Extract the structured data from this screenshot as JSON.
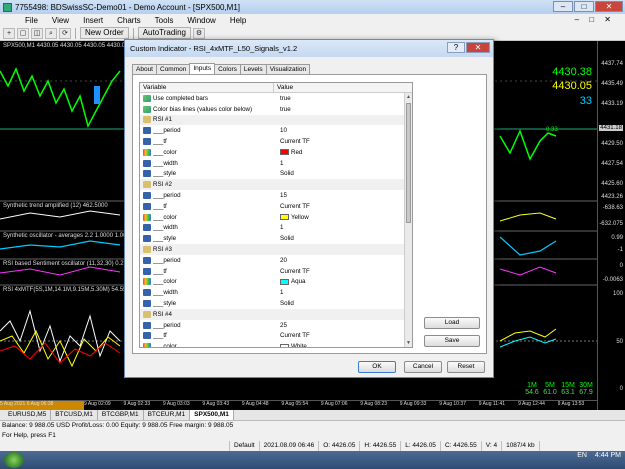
{
  "window": {
    "title": "7755498: BDSwissSC-Demo01 - Demo Account - [SPX500,M1]",
    "controls": [
      "–",
      "□",
      "✕"
    ]
  },
  "menu": {
    "items": [
      "File",
      "View",
      "Insert",
      "Charts",
      "Tools",
      "Window",
      "Help"
    ],
    "mdi_controls": "– □ ✕"
  },
  "toolbar": {
    "new_order": "New Order",
    "autotrading": "AutoTrading",
    "buttons": [
      "+",
      "▢",
      "◫",
      "⌕",
      "⟳",
      "⚙"
    ]
  },
  "chart": {
    "main_label": "SPX500,M1  4430.05 4430.05 4430.05 4430.05",
    "price_big": [
      "4430.38",
      "4430.05",
      "33"
    ],
    "price_colors": [
      "#00ff00",
      "#ffff00",
      "#00d0ff"
    ],
    "current_marker": "0.33",
    "sub_labels": [
      "Synthetic trend amplified (12) 462.5000",
      "Synthetic oscillator - averages 2.2 1.0000 1.0000",
      "RSI based Sentiment oscillator (11,32,30) 0.29",
      "RSI 4xMTF(5S,1M,14.1M,9.15M,5.30M) 54.5583 60"
    ],
    "right_axis": [
      "4437.74",
      "4435.49",
      "4433.19",
      "4431.18",
      "4429.50",
      "4427.54",
      "4425.60",
      "4423.26",
      "-638.63",
      "-632.075",
      "0.99",
      "-1",
      "0",
      "-0.0063",
      "100",
      "50",
      "0"
    ],
    "time_axis": [
      "5 Aug 2021",
      "6 Aug 06:38",
      "9 Aug 02:09",
      "9 Aug 02:33",
      "9 Aug 03:03",
      "9 Aug 03:43",
      "9 Aug 04:48",
      "9 Aug 05:54",
      "9 Aug 07:06",
      "9 Aug 08:23",
      "9 Aug 09:33",
      "9 Aug 10:37",
      "9 Aug 11:41",
      "9 Aug 12:44",
      "9 Aug 13:53"
    ],
    "mtf": {
      "headers": [
        "1M",
        "5M",
        "15M",
        "30M"
      ],
      "values": [
        "54.6",
        "61.0",
        "63.1",
        "67.9"
      ]
    }
  },
  "chart_tabs": [
    "EURUSD,M5",
    "BTCUSD,M1",
    "BTCGBP,M1",
    "BTCEUR,M1",
    "SPX500,M1"
  ],
  "active_chart_tab": "SPX500,M1",
  "account_bar": "Balance: 9 988.05 USD  Profit/Loss: 0.00  Equity: 9 988.05  Free margin: 9 988.05",
  "status": {
    "help": "For Help, press F1",
    "profile": "Default",
    "datetime": "2021.08.09 06:46",
    "open": "O: 4426.05",
    "high": "H: 4426.55",
    "low": "L: 4426.05",
    "close": "C: 4426.55",
    "volume": "V: 4",
    "traffic": "1087/4 kb"
  },
  "taskbar": {
    "lang": "EN",
    "time": "4:44 PM"
  },
  "dialog": {
    "title": "Custom Indicator - RSI_4xMTF_L50_Signals_v1.2",
    "help": "?",
    "close": "✕",
    "tabs": [
      "About",
      "Common",
      "Inputs",
      "Colors",
      "Levels",
      "Visualization"
    ],
    "active_tab": "Inputs",
    "columns": [
      "Variable",
      "Value"
    ],
    "rows": [
      {
        "icon": "bool",
        "name": "Use completed bars",
        "value": "true"
      },
      {
        "icon": "bool",
        "name": "Color bias lines (values color below)",
        "value": "true"
      },
      {
        "icon": "group",
        "name": "RSI #1",
        "value": ""
      },
      {
        "icon": "num",
        "name": "___period",
        "value": "10"
      },
      {
        "icon": "num",
        "name": "___tf",
        "value": "Current TF"
      },
      {
        "icon": "color",
        "name": "___color",
        "value": "Red",
        "swatch": "#ff0000"
      },
      {
        "icon": "num",
        "name": "___width",
        "value": "1"
      },
      {
        "icon": "num",
        "name": "___style",
        "value": "Solid"
      },
      {
        "icon": "group",
        "name": "RSI #2",
        "value": ""
      },
      {
        "icon": "num",
        "name": "___period",
        "value": "15"
      },
      {
        "icon": "num",
        "name": "___tf",
        "value": "Current TF"
      },
      {
        "icon": "color",
        "name": "___color",
        "value": "Yellow",
        "swatch": "#ffff00"
      },
      {
        "icon": "num",
        "name": "___width",
        "value": "1"
      },
      {
        "icon": "num",
        "name": "___style",
        "value": "Solid"
      },
      {
        "icon": "group",
        "name": "RSI #3",
        "value": ""
      },
      {
        "icon": "num",
        "name": "___period",
        "value": "20"
      },
      {
        "icon": "num",
        "name": "___tf",
        "value": "Current TF"
      },
      {
        "icon": "color",
        "name": "___color",
        "value": "Aqua",
        "swatch": "#00ffff"
      },
      {
        "icon": "num",
        "name": "___width",
        "value": "1"
      },
      {
        "icon": "num",
        "name": "___style",
        "value": "Solid"
      },
      {
        "icon": "group",
        "name": "RSI #4",
        "value": ""
      },
      {
        "icon": "num",
        "name": "___period",
        "value": "25"
      },
      {
        "icon": "num",
        "name": "___tf",
        "value": "Current TF"
      },
      {
        "icon": "color",
        "name": "___color",
        "value": "White",
        "swatch": "#ffffff"
      }
    ],
    "buttons": {
      "load": "Load",
      "save": "Save",
      "ok": "OK",
      "cancel": "Cancel",
      "reset": "Reset"
    }
  }
}
